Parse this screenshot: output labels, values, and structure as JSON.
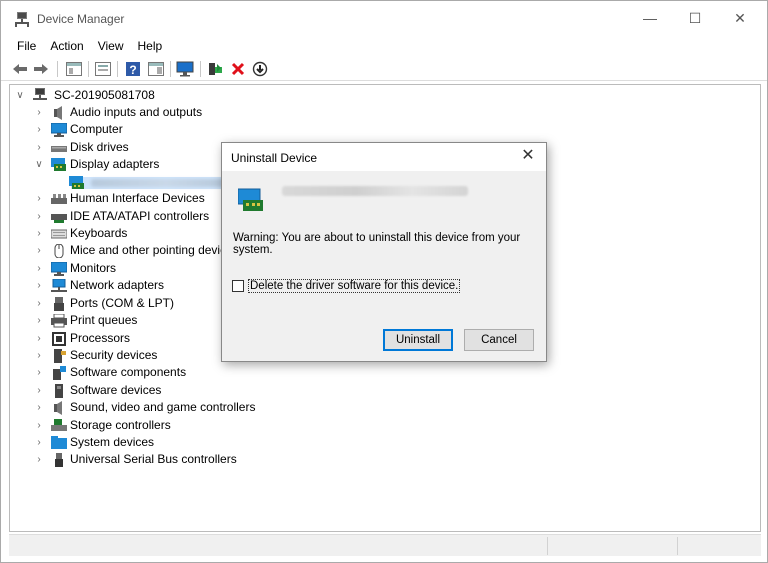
{
  "window": {
    "title": "Device Manager",
    "controls": {
      "minimize": "—",
      "maximize": "☐",
      "close": "✕"
    }
  },
  "menu": [
    "File",
    "Action",
    "View",
    "Help"
  ],
  "tree": {
    "root": "SC-201905081708",
    "items": [
      {
        "label": "Audio inputs and outputs",
        "icon": "speaker-icon",
        "expanded": false
      },
      {
        "label": "Computer",
        "icon": "monitor-icon",
        "expanded": false
      },
      {
        "label": "Disk drives",
        "icon": "disk-icon",
        "expanded": false
      },
      {
        "label": "Display adapters",
        "icon": "display-adapter-icon",
        "expanded": true
      },
      {
        "label": "Human Interface Devices",
        "icon": "hid-icon",
        "expanded": false
      },
      {
        "label": "IDE ATA/ATAPI controllers",
        "icon": "ide-icon",
        "expanded": false
      },
      {
        "label": "Keyboards",
        "icon": "keyboard-icon",
        "expanded": false
      },
      {
        "label": "Mice and other pointing devic",
        "icon": "mouse-icon",
        "expanded": false
      },
      {
        "label": "Monitors",
        "icon": "monitor-icon",
        "expanded": false
      },
      {
        "label": "Network adapters",
        "icon": "network-icon",
        "expanded": false
      },
      {
        "label": "Ports (COM & LPT)",
        "icon": "port-icon",
        "expanded": false
      },
      {
        "label": "Print queues",
        "icon": "printer-icon",
        "expanded": false
      },
      {
        "label": "Processors",
        "icon": "processor-icon",
        "expanded": false
      },
      {
        "label": "Security devices",
        "icon": "security-icon",
        "expanded": false
      },
      {
        "label": "Software components",
        "icon": "software-component-icon",
        "expanded": false
      },
      {
        "label": "Software devices",
        "icon": "software-device-icon",
        "expanded": false
      },
      {
        "label": "Sound, video and game controllers",
        "icon": "speaker-icon",
        "expanded": false
      },
      {
        "label": "Storage controllers",
        "icon": "storage-icon",
        "expanded": false
      },
      {
        "label": "System devices",
        "icon": "system-folder-icon",
        "expanded": false
      },
      {
        "label": "Universal Serial Bus controllers",
        "icon": "usb-icon",
        "expanded": false
      }
    ]
  },
  "dialog": {
    "title": "Uninstall Device",
    "warning": "Warning: You are about to uninstall this device from your system.",
    "checkbox_label": "Delete the driver software for this device.",
    "checkbox_checked": false,
    "uninstall_button": "Uninstall",
    "cancel_button": "Cancel"
  },
  "colors": {
    "accent": "#0078d7",
    "dialog_bg": "#f0f0f0",
    "selection": "#cce4fb"
  }
}
